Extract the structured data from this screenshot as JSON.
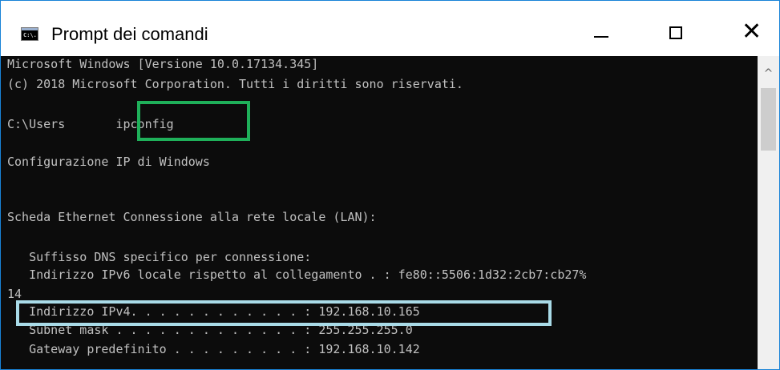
{
  "window": {
    "title": "Prompt dei comandi",
    "icon_label": "C:\\.",
    "controls": {
      "minimize": "—",
      "maximize": "☐",
      "close": "✕"
    }
  },
  "console": {
    "lines": [
      "Microsoft Windows [Versione 10.0.17134.345]",
      "(c) 2018 Microsoft Corporation. Tutti i diritti sono riservati.",
      "",
      "C:\\Users       ipconfig",
      "",
      "Configurazione IP di Windows",
      "",
      "",
      "Scheda Ethernet Connessione alla rete locale (LAN):",
      "",
      "   Suffisso DNS specifico per connessione:",
      "   Indirizzo IPv6 locale rispetto al collegamento . : fe80::5506:1d32:2cb7:cb27%",
      "14",
      "   Indirizzo IPv4. . . . . . . . . . . . : 192.168.10.165",
      "   Subnet mask . . . . . . . . . . . . . : 255.255.255.0",
      "   Gateway predefinito . . . . . . . . . : 192.168.10.142"
    ]
  },
  "highlights": {
    "command_color": "#1fb05a",
    "ipv4_color": "#a9dbe8"
  },
  "scrollbar": {
    "up_arrow": "^"
  }
}
